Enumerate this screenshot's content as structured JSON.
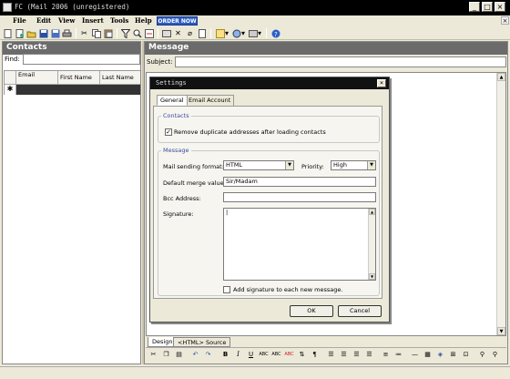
{
  "window": {
    "title": "FC (Mail 2006 (unregistered)"
  },
  "menu": {
    "items": [
      "File",
      "Edit",
      "View",
      "Insert",
      "Tools",
      "Help"
    ],
    "order_now": "ORDER NOW"
  },
  "contacts_panel": {
    "title": "Contacts",
    "find_label": "Find:",
    "columns": [
      "Email",
      "First Name",
      "Last Name"
    ],
    "new_row_marker": "✱"
  },
  "message_panel": {
    "title": "Message",
    "subject_label": "Subject:",
    "tabs": [
      "Design",
      "<HTML> Source"
    ]
  },
  "dialog": {
    "title": "Settings",
    "tabs": [
      "General",
      "Email Account"
    ],
    "contacts_group": {
      "label": "Contacts",
      "remove_duplicates_label": "Remove duplicate addresses after loading contacts",
      "remove_duplicates_checked": true
    },
    "message_group": {
      "label": "Message",
      "mail_format_label": "Mail sending format:",
      "mail_format_value": "HTML",
      "priority_label": "Priority:",
      "priority_value": "High",
      "merge_label": "Default merge value:",
      "merge_value": "Sir/Madam",
      "bcc_label": "Bcc Address:",
      "bcc_value": "",
      "signature_label": "Signature:",
      "signature_value": "|",
      "add_signature_label": "Add signature to each new message.",
      "add_signature_checked": false
    },
    "ok_label": "OK",
    "cancel_label": "Cancel"
  },
  "colors": {
    "titlebar": "#000000",
    "panel_header": "#6b6b6b",
    "order_button": "#2b5cc4",
    "group_label": "#3a4d9c"
  }
}
